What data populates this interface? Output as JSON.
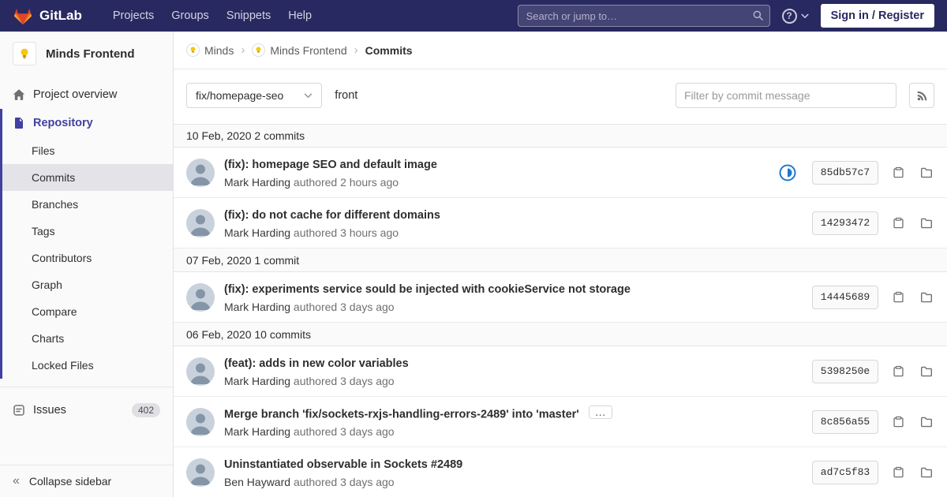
{
  "navbar": {
    "brand": "GitLab",
    "links": [
      "Projects",
      "Groups",
      "Snippets",
      "Help"
    ],
    "search_placeholder": "Search or jump to…",
    "sign_in_label": "Sign in / Register"
  },
  "sidebar": {
    "project_name": "Minds Frontend",
    "overview_label": "Project overview",
    "repository_label": "Repository",
    "repo_subitems": [
      "Files",
      "Commits",
      "Branches",
      "Tags",
      "Contributors",
      "Graph",
      "Compare",
      "Charts",
      "Locked Files"
    ],
    "issues_label": "Issues",
    "issues_count": "402",
    "collapse_label": "Collapse sidebar"
  },
  "breadcrumb": {
    "items": [
      "Minds",
      "Minds Frontend",
      "Commits"
    ]
  },
  "controls": {
    "branch_dropdown_value": "fix/homepage-seo",
    "path_label": "front",
    "filter_placeholder": "Filter by commit message"
  },
  "icons": {
    "collapse": "«",
    "breadcrumb_separator": "›",
    "help": "?",
    "expand_commit": "…"
  },
  "colors": {
    "navbar_bg": "#292961",
    "sidebar_accent": "#41419f",
    "ci_running_blue": "#1f78d1",
    "brand_orange": "#fc6d26"
  },
  "commits": {
    "groups": [
      {
        "date_header": "10 Feb, 2020 2 commits",
        "commits": [
          {
            "title": "(fix): homepage SEO and default image",
            "author": "Mark Harding",
            "authored": "authored 2 hours ago",
            "sha": "85db57c7",
            "ci_status": "running"
          },
          {
            "title": "(fix): do not cache for different domains",
            "author": "Mark Harding",
            "authored": "authored 3 hours ago",
            "sha": "14293472"
          }
        ]
      },
      {
        "date_header": "07 Feb, 2020 1 commit",
        "commits": [
          {
            "title": "(fix): experiments service sould be injected with cookieService not storage",
            "author": "Mark Harding",
            "authored": "authored 3 days ago",
            "sha": "14445689"
          }
        ]
      },
      {
        "date_header": "06 Feb, 2020 10 commits",
        "commits": [
          {
            "title": "(feat): adds in new color variables",
            "author": "Mark Harding",
            "authored": "authored 3 days ago",
            "sha": "5398250e"
          },
          {
            "title": "Merge branch 'fix/sockets-rxjs-handling-errors-2489' into 'master'",
            "author": "Mark Harding",
            "authored": "authored 3 days ago",
            "sha": "8c856a55",
            "expandable": true
          },
          {
            "title": "Uninstantiated observable in Sockets #2489",
            "author": "Ben Hayward",
            "authored": "authored 3 days ago",
            "sha": "ad7c5f83"
          }
        ]
      }
    ]
  }
}
